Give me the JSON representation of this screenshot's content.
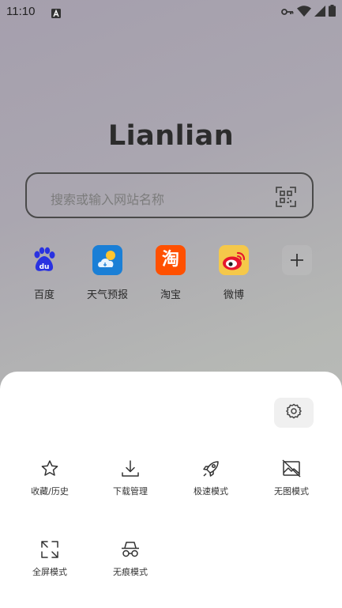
{
  "status_bar": {
    "time": "11:10"
  },
  "logo": {
    "text": "Lianlian"
  },
  "search": {
    "placeholder": "搜索或输入网站名称"
  },
  "shortcuts": [
    {
      "label": "百度",
      "icon": "baidu-icon",
      "color": "#2932e1"
    },
    {
      "label": "天气预报",
      "icon": "weather-icon",
      "color": "#1a7fd6"
    },
    {
      "label": "淘宝",
      "icon": "taobao-icon",
      "color": "#ff5000",
      "glyph": "淘"
    },
    {
      "label": "微博",
      "icon": "weibo-icon",
      "color": "#e6162d"
    },
    {
      "label": "",
      "icon": "add-icon"
    }
  ],
  "sheet": {
    "menu": [
      {
        "label": "收藏/历史",
        "icon": "star-icon"
      },
      {
        "label": "下载管理",
        "icon": "download-icon"
      },
      {
        "label": "极速模式",
        "icon": "rocket-icon"
      },
      {
        "label": "无图模式",
        "icon": "no-image-icon"
      },
      {
        "label": "全屏模式",
        "icon": "fullscreen-icon"
      },
      {
        "label": "无痕模式",
        "icon": "incognito-icon"
      }
    ]
  }
}
